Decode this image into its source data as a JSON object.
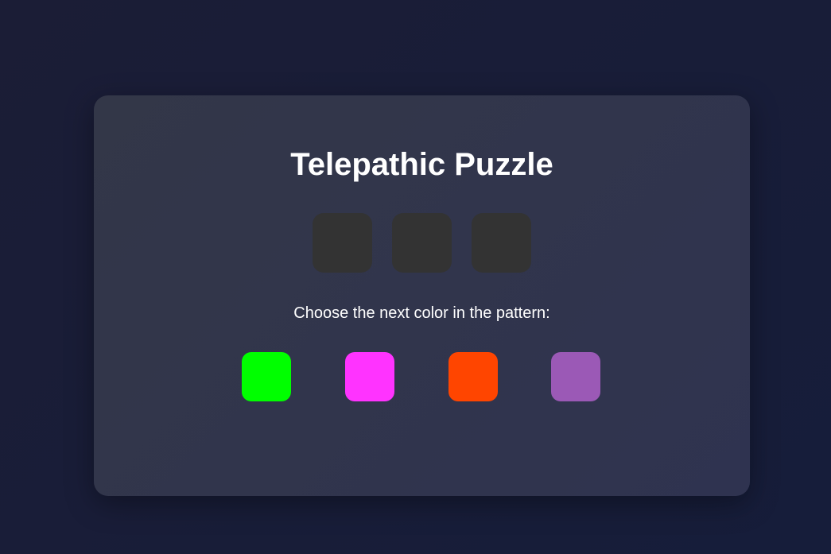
{
  "title": "Telepathic Puzzle",
  "instruction": "Choose the next color in the pattern:",
  "pattern_slots": [
    {
      "color": "#333333"
    },
    {
      "color": "#333333"
    },
    {
      "color": "#333333"
    }
  ],
  "color_options": [
    {
      "name": "green",
      "color": "#00ff00"
    },
    {
      "name": "magenta",
      "color": "#ff33ff"
    },
    {
      "name": "orange-red",
      "color": "#ff4500"
    },
    {
      "name": "purple",
      "color": "#9b59b6"
    }
  ]
}
